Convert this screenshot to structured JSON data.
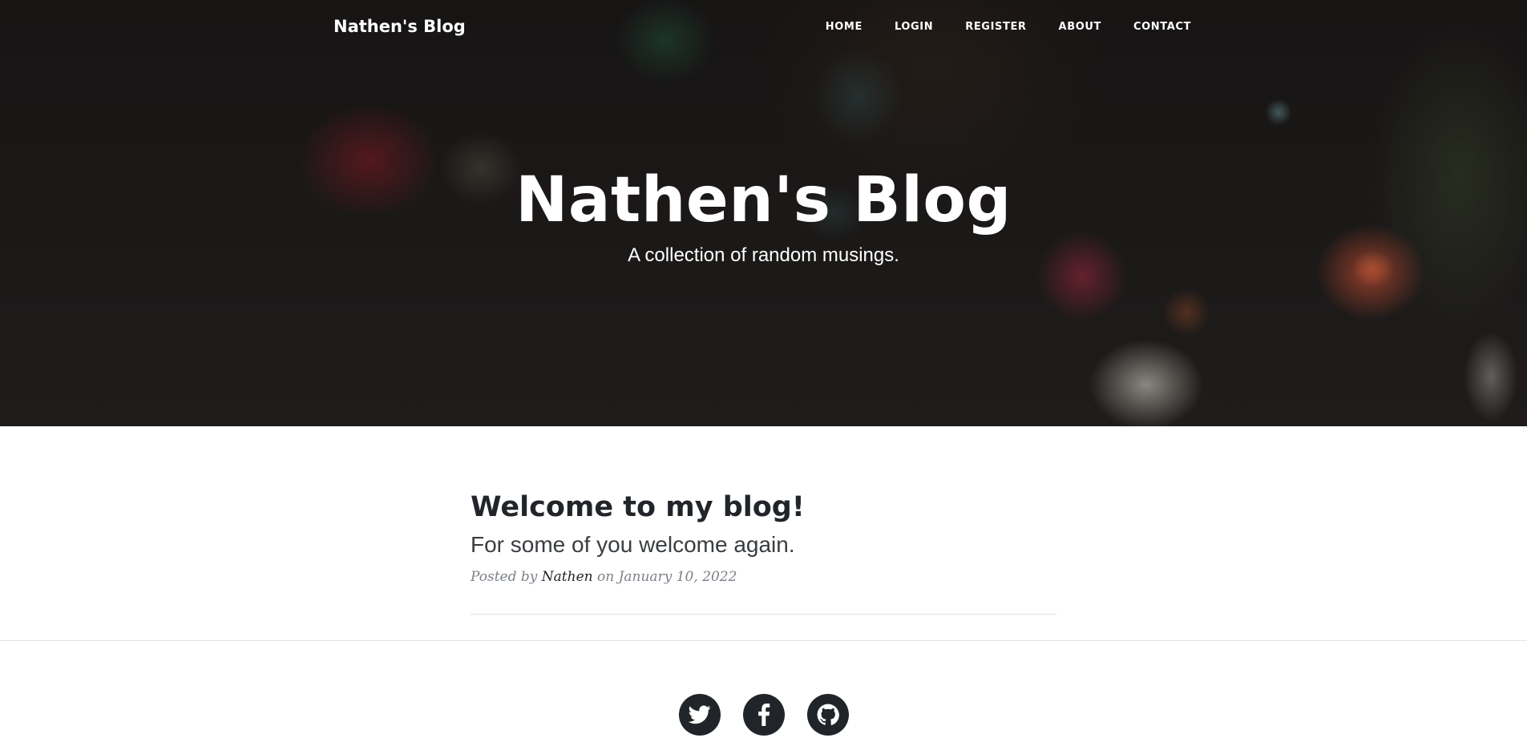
{
  "nav": {
    "brand": "Nathen's Blog",
    "items": [
      {
        "label": "HOME"
      },
      {
        "label": "LOGIN"
      },
      {
        "label": "REGISTER"
      },
      {
        "label": "ABOUT"
      },
      {
        "label": "CONTACT"
      }
    ]
  },
  "header": {
    "title": "Nathen's Blog",
    "subtitle": "A collection of random musings."
  },
  "post": {
    "title": "Welcome to my blog!",
    "subtitle": "For some of you welcome again.",
    "meta_prefix": "Posted by",
    "author": "Nathen",
    "meta_date": "on January 10, 2022"
  },
  "footer": {
    "social": [
      {
        "icon": "twitter-icon"
      },
      {
        "icon": "facebook-icon"
      },
      {
        "icon": "github-icon"
      }
    ]
  },
  "colors": {
    "text_dark": "#212529",
    "meta_gray": "#7b8188",
    "divider": "#dee2e6"
  }
}
